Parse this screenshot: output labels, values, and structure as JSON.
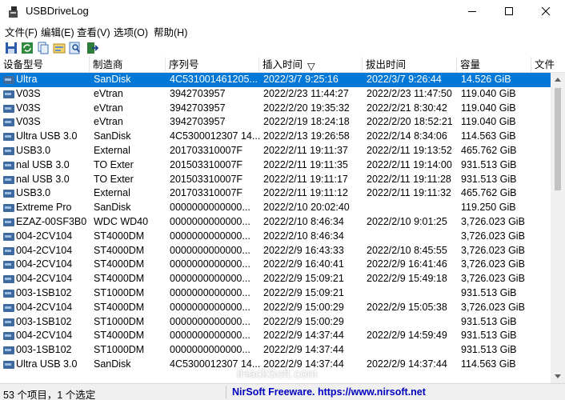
{
  "window": {
    "title": "USBDriveLog",
    "controls": {
      "minimize": "minimize",
      "maximize": "maximize",
      "close": "close"
    }
  },
  "menu": [
    {
      "label": "文件(F)"
    },
    {
      "label": "编辑(E)"
    },
    {
      "label": "查看(V)"
    },
    {
      "label": "选项(O)"
    },
    {
      "label": "帮助(H)"
    }
  ],
  "toolbar": [
    {
      "icon": "save-icon"
    },
    {
      "icon": "refresh-icon"
    },
    {
      "icon": "copy-icon"
    },
    {
      "icon": "properties-icon"
    },
    {
      "icon": "find-icon"
    },
    {
      "icon": "exit-icon"
    }
  ],
  "table": {
    "columns": [
      "设备型号",
      "制造商",
      "序列号",
      "插入时间",
      "拔出时间",
      "容量",
      "文件"
    ],
    "sort_indicator": "▽",
    "selected_row_index": 0,
    "rows": [
      [
        "Ultra",
        "SanDisk",
        "4C531001461205...",
        "2022/3/7 9:25:16",
        "2022/3/7 9:26:44",
        "14.526 GiB"
      ],
      [
        "V03S",
        "eVtran",
        "3942703957",
        "2022/2/23 11:44:27",
        "2022/2/23 11:47:50",
        "119.040 GiB"
      ],
      [
        "V03S",
        "eVtran",
        "3942703957",
        "2022/2/20 19:35:32",
        "2022/2/21 8:30:42",
        "119.040 GiB"
      ],
      [
        "V03S",
        "eVtran",
        "3942703957",
        "2022/2/19 18:24:18",
        "2022/2/20 18:52:21",
        "119.040 GiB"
      ],
      [
        "Ultra USB 3.0",
        "SanDisk",
        "4C5300012307 14...",
        "2022/2/13 19:26:58",
        "2022/2/14 8:34:06",
        "114.563 GiB"
      ],
      [
        "USB3.0",
        "External",
        "201703310007F",
        "2022/2/11 19:11:37",
        "2022/2/11 19:13:52",
        "465.762 GiB"
      ],
      [
        "nal USB 3.0",
        "TO Exter",
        "201503310007F",
        "2022/2/11 19:11:35",
        "2022/2/11 19:14:00",
        "931.513 GiB"
      ],
      [
        "nal USB 3.0",
        "TO Exter",
        "201503310007F",
        "2022/2/11 19:11:17",
        "2022/2/11 19:11:28",
        "931.513 GiB"
      ],
      [
        "USB3.0",
        "External",
        "201703310007F",
        "2022/2/11 19:11:12",
        "2022/2/11 19:11:32",
        "465.762 GiB"
      ],
      [
        "Extreme Pro",
        "SanDisk",
        "0000000000000...",
        "2022/2/10 20:02:40",
        "",
        "119.250 GiB"
      ],
      [
        "EZAZ-00SF3B0",
        "WDC WD40",
        "0000000000000...",
        "2022/2/10 8:46:34",
        "2022/2/10 9:01:25",
        "3,726.023 GiB"
      ],
      [
        "004-2CV104",
        "ST4000DM",
        "0000000000000...",
        "2022/2/10 8:46:34",
        "",
        "3,726.023 GiB"
      ],
      [
        "004-2CV104",
        "ST4000DM",
        "0000000000000...",
        "2022/2/9 16:43:33",
        "2022/2/10 8:45:55",
        "3,726.023 GiB"
      ],
      [
        "004-2CV104",
        "ST4000DM",
        "0000000000000...",
        "2022/2/9 16:40:41",
        "2022/2/9 16:41:46",
        "3,726.023 GiB"
      ],
      [
        "004-2CV104",
        "ST4000DM",
        "0000000000000...",
        "2022/2/9 15:09:21",
        "2022/2/9 15:49:18",
        "3,726.023 GiB"
      ],
      [
        "003-1SB102",
        "ST1000DM",
        "0000000000000...",
        "2022/2/9 15:09:21",
        "",
        "931.513 GiB"
      ],
      [
        "004-2CV104",
        "ST4000DM",
        "0000000000000...",
        "2022/2/9 15:00:29",
        "2022/2/9 15:05:38",
        "3,726.023 GiB"
      ],
      [
        "003-1SB102",
        "ST1000DM",
        "0000000000000...",
        "2022/2/9 15:00:29",
        "",
        "931.513 GiB"
      ],
      [
        "004-2CV104",
        "ST4000DM",
        "0000000000000...",
        "2022/2/9 14:37:44",
        "2022/2/9 14:59:49",
        "931.513 GiB"
      ],
      [
        "003-1SB102",
        "ST1000DM",
        "0000000000000...",
        "2022/2/9 14:37:44",
        "",
        "931.513 GiB"
      ],
      [
        "Ultra USB 3.0",
        "SanDisk",
        "4C5300012307 14...",
        "2022/2/9 14:37:44",
        "2022/2/9 14:37:44",
        "114.563 GiB"
      ]
    ]
  },
  "status": {
    "left": "53 个项目，1 个选定",
    "right": "NirSoft Freeware. https://www.nirsoft.net"
  },
  "watermark": "iHackSoft.com"
}
